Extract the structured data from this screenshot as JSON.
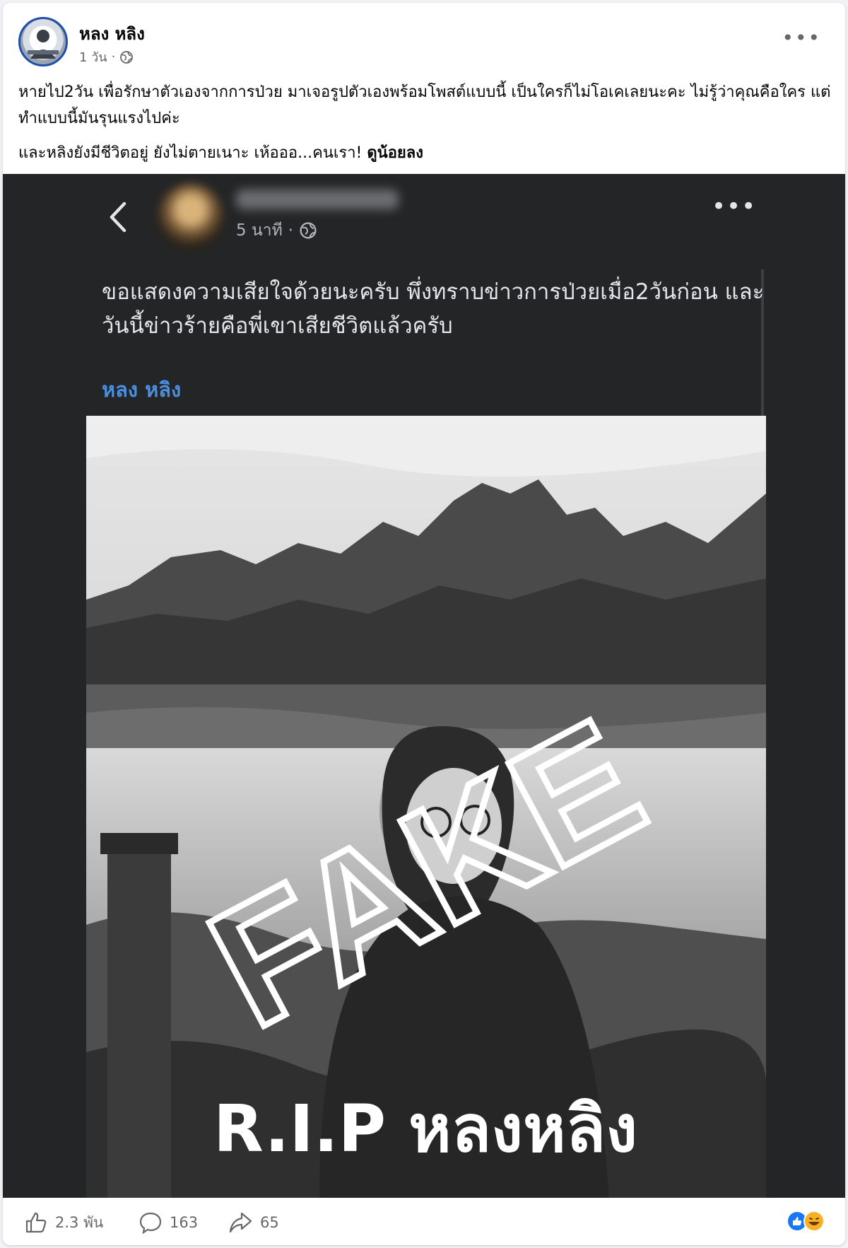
{
  "post": {
    "author": "หลง หลิง",
    "time": "1 วัน",
    "more_label": "•••",
    "paragraph1": "หายไป2วัน เพื่อรักษาตัวเองจากการป่วย มาเจอรูปตัวเองพร้อมโพสต์แบบนี้ เป็นใครก็ไม่โอเคเลยนะคะ ไม่รู้ว่าคุณคือใคร แต่ทำแบบนี้มันรุนแรงไปค่ะ",
    "paragraph2": "และหลิงยังมีชีวิตอยู่ ยังไม่ตายเนาะ เห้อออ...คนเรา!",
    "see_less": "ดูน้อยลง"
  },
  "embedded": {
    "time": "5 นาที",
    "more_label": "•••",
    "text": "ขอแสดงความเสียใจด้วยนะครับ พึ่งทราบข่าวการป่วยเมื่อ2วันก่อน และวันนี้ข่าวร้ายคือพี่เขาเสียชีวิตแล้วครับ",
    "tag": "หลง หลิง",
    "watermark": "FAKE",
    "caption": "R.I.P หลงหลิง"
  },
  "footer": {
    "likes": "2.3 พัน",
    "comments": "163",
    "shares": "65"
  },
  "icons": {
    "back": "chevron-left-icon",
    "globe": "globe-icon",
    "like": "thumbs-up-icon",
    "comment": "comment-icon",
    "share": "share-icon",
    "reactions": "like-haha-reaction-icons"
  },
  "colors": {
    "link_blue": "#4a8fe0",
    "embed_bg": "#242526",
    "meta_gray": "#65676b"
  }
}
